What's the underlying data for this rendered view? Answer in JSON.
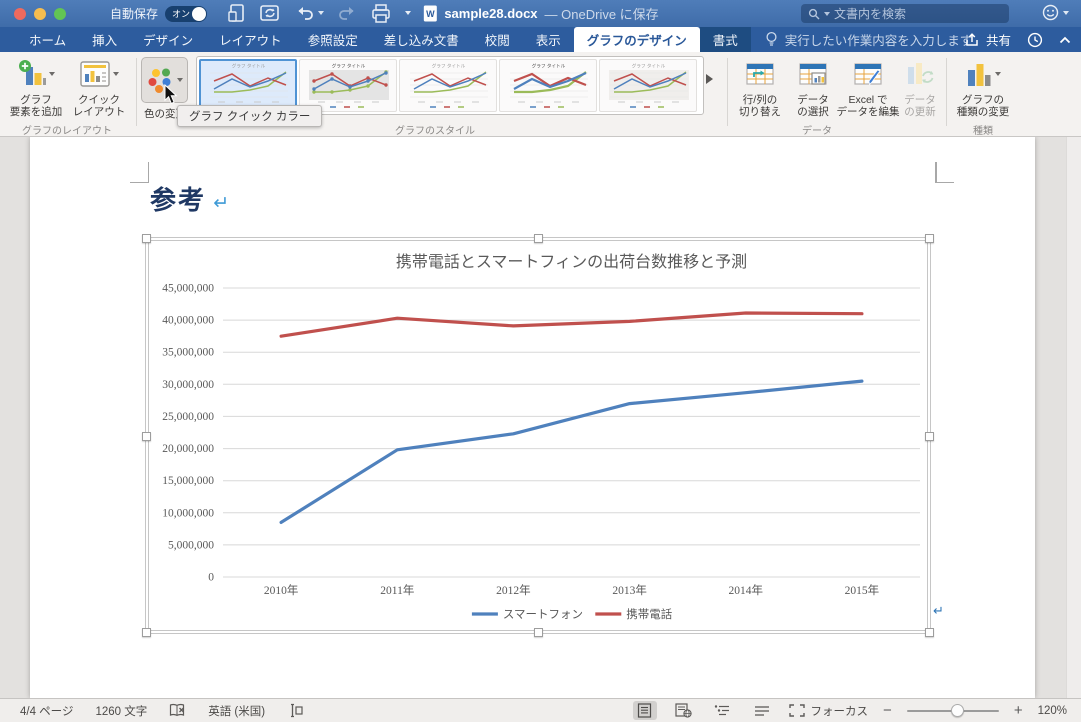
{
  "titlebar": {
    "autosave_label": "自動保存",
    "autosave_state": "オン",
    "doc_title": "sample28.docx",
    "doc_title_suffix": "— OneDrive に保存",
    "search_placeholder": "文書内を検索"
  },
  "tabs": {
    "items": [
      {
        "key": "home",
        "label": "ホーム"
      },
      {
        "key": "insert",
        "label": "挿入"
      },
      {
        "key": "design",
        "label": "デザイン"
      },
      {
        "key": "layout",
        "label": "レイアウト"
      },
      {
        "key": "references",
        "label": "参照設定"
      },
      {
        "key": "mailings",
        "label": "差し込み文書"
      },
      {
        "key": "review",
        "label": "校閲"
      },
      {
        "key": "view",
        "label": "表示"
      },
      {
        "key": "chart-design",
        "label": "グラフのデザイン",
        "active": true
      },
      {
        "key": "format",
        "label": "書式",
        "contextual": true
      }
    ],
    "assistant_hint": "実行したい作業内容を入力します",
    "share_label": "共有"
  },
  "ribbon": {
    "chart_layout_group": {
      "label": "グラフのレイアウト",
      "add_element": "グラフ\n要素を追加",
      "quick_layout": "クイック\nレイアウト"
    },
    "chart_styles_group": {
      "label": "グラフのスタイル",
      "change_colors": "色の変更",
      "thumb_title": "グラフ タイトル",
      "thumb_count": 5
    },
    "data_group": {
      "label": "データ",
      "switch_row_col": "行/列の\n切り替え",
      "select_data": "データ\nの選択",
      "edit_in_excel": "Excel で\nデータを編集",
      "refresh_data": "データ\nの更新"
    },
    "type_group": {
      "label": "種類",
      "change_chart_type": "グラフの\n種類の変更"
    },
    "tooltip": "グラフ クイック カラー"
  },
  "document": {
    "heading": "参考"
  },
  "chart_data": {
    "type": "line",
    "title": "携帯電話とスマートフィンの出荷台数推移と予測",
    "categories": [
      "2010年",
      "2011年",
      "2012年",
      "2013年",
      "2014年",
      "2015年"
    ],
    "series": [
      {
        "name": "スマートフォン",
        "color": "#4f81bd",
        "values": [
          8500000,
          19800000,
          22300000,
          27000000,
          28700000,
          30500000
        ]
      },
      {
        "name": "携帯電話",
        "color": "#c0504d",
        "values": [
          37500000,
          40300000,
          39100000,
          39800000,
          41100000,
          41000000
        ]
      }
    ],
    "ylim": [
      0,
      45000000
    ],
    "ytick_step": 5000000,
    "ytick_labels": [
      "0",
      "5,000,000",
      "10,000,000",
      "15,000,000",
      "20,000,000",
      "25,000,000",
      "30,000,000",
      "35,000,000",
      "40,000,000",
      "45,000,000"
    ],
    "grid": true,
    "legend_position": "bottom"
  },
  "statusbar": {
    "page": "4/4 ページ",
    "chars": "1260 文字",
    "language": "英語 (米国)",
    "focus_label": "フォーカス",
    "zoom_label": "120%"
  }
}
